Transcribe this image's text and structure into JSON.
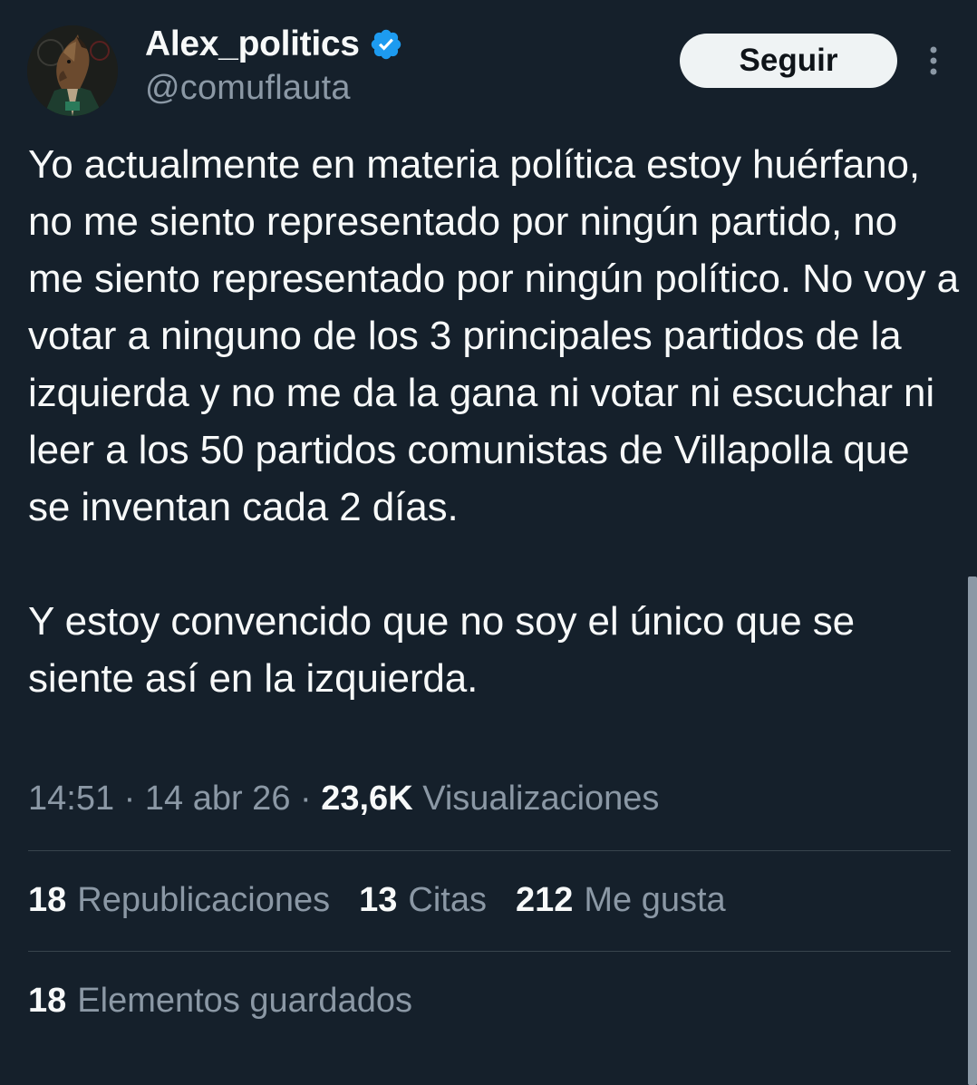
{
  "author": {
    "display_name": "Alex_politics",
    "handle": "@comuflauta",
    "avatar_icon": "horse-mask-avatar-icon",
    "verified_icon": "verified-badge-icon",
    "verified_color": "#1d9bf0"
  },
  "actions": {
    "follow_label": "Seguir",
    "more_icon": "more-options-icon"
  },
  "tweet": {
    "text": "Yo actualmente en materia política estoy huérfano, no me siento representado por ningún partido, no me siento representado por ningún político. No voy a votar a ninguno de los 3 principales partidos de la izquierda y no me da la gana ni votar ni escuchar ni leer a los 50 partidos comunistas de Villapolla que se inventan cada 2 días.\n\nY estoy convencido que no soy el único que se siente así en la izquierda."
  },
  "meta": {
    "time": "14:51",
    "sep1": " · ",
    "date": "14 abr 26",
    "sep2": " · ",
    "views_count": "23,6K",
    "views_label": "Visualizaciones"
  },
  "stats": {
    "reposts_count": "18",
    "reposts_label": "Republicaciones",
    "quotes_count": "13",
    "quotes_label": "Citas",
    "likes_count": "212",
    "likes_label": "Me gusta",
    "bookmarks_count": "18",
    "bookmarks_label": "Elementos guardados"
  },
  "colors": {
    "background": "#15202b",
    "text_primary": "#f7f9f9",
    "text_secondary": "#8b98a5",
    "divider": "#38444d",
    "button_bg": "#eff3f4"
  }
}
